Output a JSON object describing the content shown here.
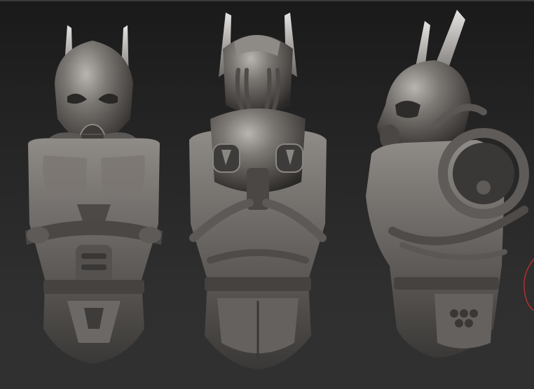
{
  "scene": {
    "background_top": "#1a1a1a",
    "background_bottom": "#303030",
    "material_color": "#6e6a67",
    "accent_edge_color": "#b03030"
  },
  "models": [
    {
      "view": "front"
    },
    {
      "view": "back"
    },
    {
      "view": "side"
    }
  ]
}
